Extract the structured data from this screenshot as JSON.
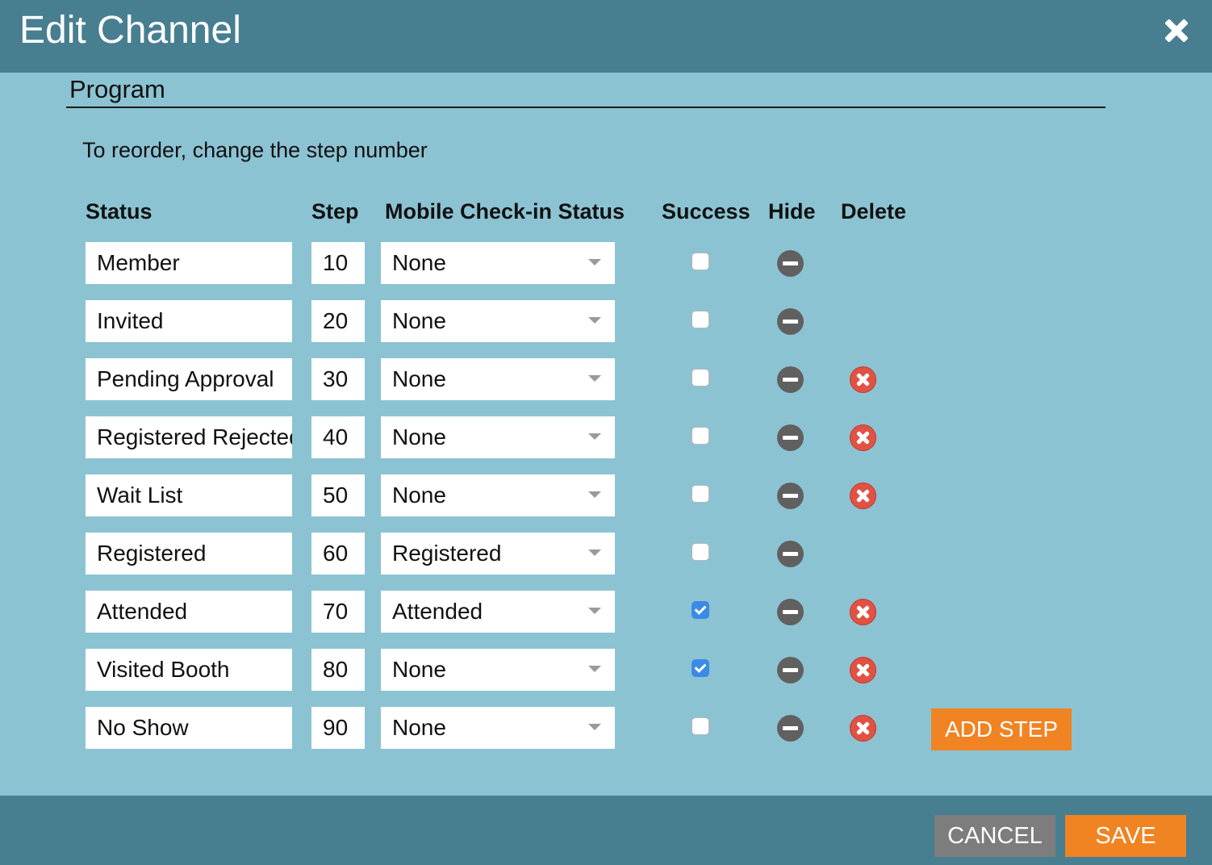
{
  "dialog": {
    "title": "Edit Channel",
    "close_icon": "close-icon"
  },
  "section": {
    "title": "Program",
    "instruction": "To reorder, change the step number"
  },
  "table": {
    "headers": {
      "status": "Status",
      "step": "Step",
      "mobile": "Mobile Check-in Status",
      "success": "Success",
      "hide": "Hide",
      "delete": "Delete"
    },
    "rows": [
      {
        "status": "Member",
        "step": "10",
        "mobile": "None",
        "success": false,
        "deletable": false
      },
      {
        "status": "Invited",
        "step": "20",
        "mobile": "None",
        "success": false,
        "deletable": false
      },
      {
        "status": "Pending Approval",
        "step": "30",
        "mobile": "None",
        "success": false,
        "deletable": true
      },
      {
        "status": "Registered Rejected",
        "step": "40",
        "mobile": "None",
        "success": false,
        "deletable": true
      },
      {
        "status": "Wait List",
        "step": "50",
        "mobile": "None",
        "success": false,
        "deletable": true
      },
      {
        "status": "Registered",
        "step": "60",
        "mobile": "Registered",
        "success": false,
        "deletable": false
      },
      {
        "status": "Attended",
        "step": "70",
        "mobile": "Attended",
        "success": true,
        "deletable": true
      },
      {
        "status": "Visited Booth",
        "step": "80",
        "mobile": "None",
        "success": true,
        "deletable": true
      },
      {
        "status": "No Show",
        "step": "90",
        "mobile": "None",
        "success": false,
        "deletable": true
      }
    ]
  },
  "actions": {
    "add_step": "ADD STEP",
    "cancel": "CANCEL",
    "save": "SAVE"
  },
  "colors": {
    "header_bar": "#477f91",
    "body_bg": "#8cc3d3",
    "accent_orange": "#f08322",
    "cancel_gray": "#7d7d7d",
    "delete_red": "#e05243",
    "checkbox_blue": "#3b8ae6"
  }
}
